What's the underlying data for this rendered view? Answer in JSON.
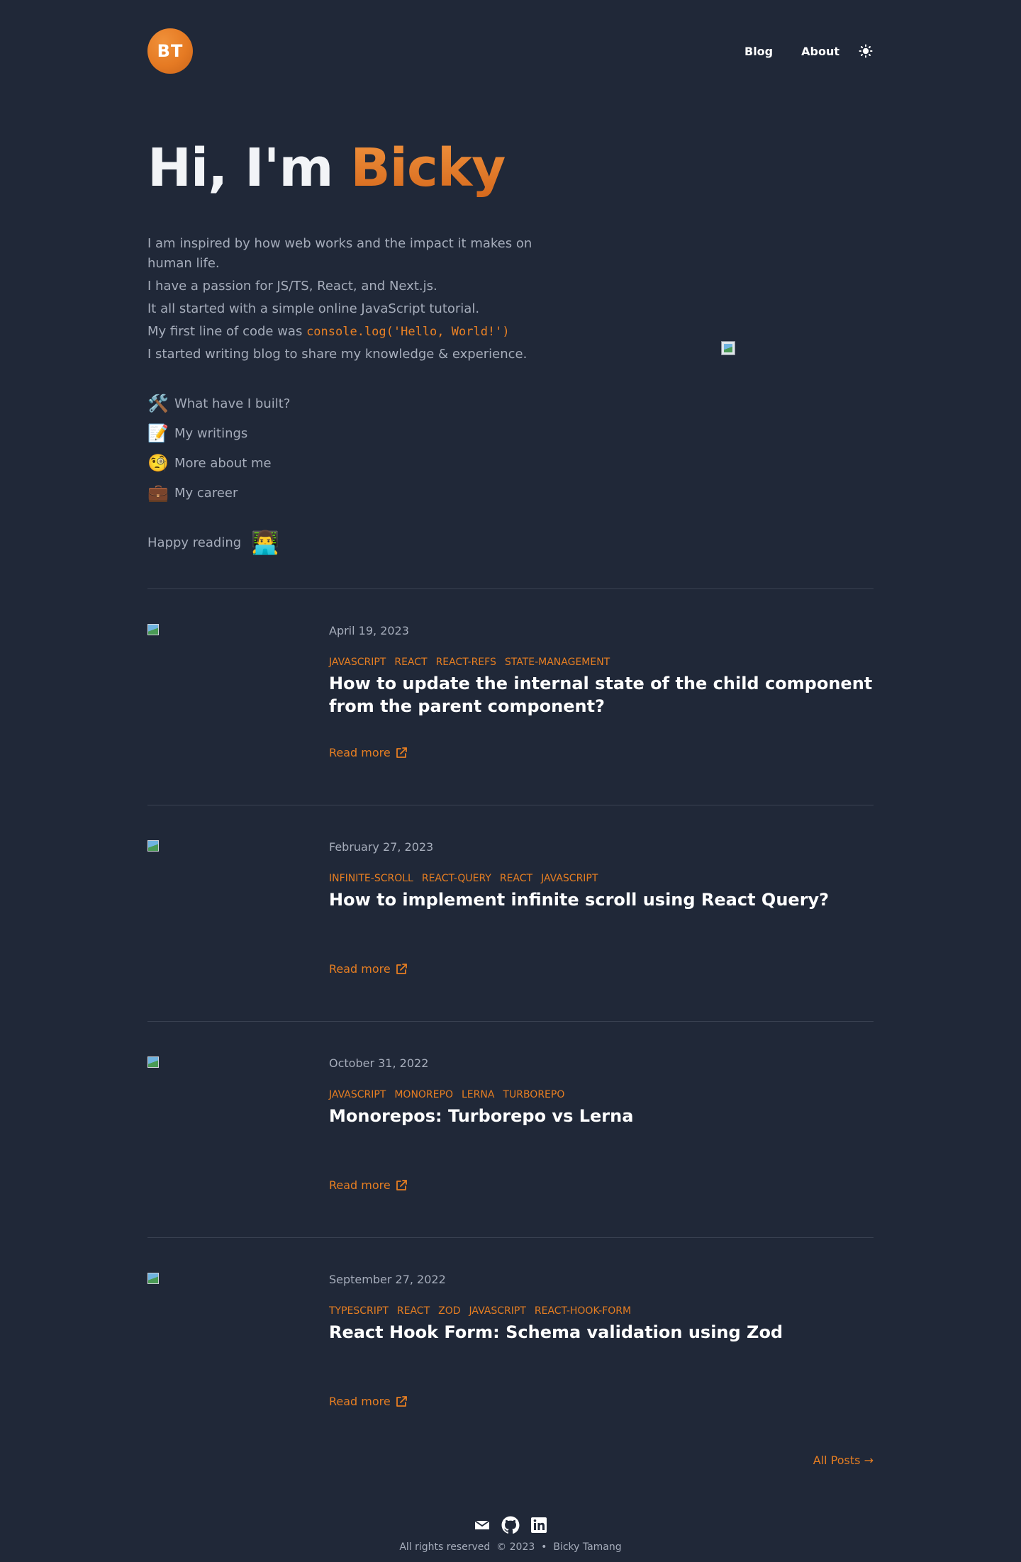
{
  "header": {
    "logo_text": "BT",
    "nav": [
      {
        "label": "Blog"
      },
      {
        "label": "About"
      }
    ],
    "theme_toggle_icon": "sun-icon"
  },
  "hero": {
    "greeting": "Hi, I'm ",
    "name": "Bicky",
    "intro": [
      "I am inspired by how web works and the impact it makes on human life.",
      "I have a passion for JS/TS, React, and Next.js.",
      "It all started with a simple online JavaScript tutorial.",
      "I started writing blog to share my knowledge & experience."
    ],
    "first_code_prefix": "My first line of code was ",
    "first_code": "console.log('Hello, World!')",
    "links": [
      {
        "emoji": "🛠️",
        "label": "What have I built?"
      },
      {
        "emoji": "📝",
        "label": "My writings"
      },
      {
        "emoji": "🧐",
        "label": "More about me"
      },
      {
        "emoji": "💼",
        "label": "My career"
      }
    ],
    "happy_text": "Happy reading",
    "happy_emoji": "👨‍💻"
  },
  "posts": [
    {
      "date": "April 19, 2023",
      "tags": [
        "JAVASCRIPT",
        "REACT",
        "REACT-REFS",
        "STATE-MANAGEMENT"
      ],
      "title": "How to update the internal state of the child component from the parent component?",
      "read_more": "Read more"
    },
    {
      "date": "February 27, 2023",
      "tags": [
        "INFINITE-SCROLL",
        "REACT-QUERY",
        "REACT",
        "JAVASCRIPT"
      ],
      "title": "How to implement infinite scroll using React Query?",
      "read_more": "Read more"
    },
    {
      "date": "October 31, 2022",
      "tags": [
        "JAVASCRIPT",
        "MONOREPO",
        "LERNA",
        "TURBOREPO"
      ],
      "title": "Monorepos: Turborepo vs Lerna",
      "read_more": "Read more"
    },
    {
      "date": "September 27, 2022",
      "tags": [
        "TYPESCRIPT",
        "REACT",
        "ZOD",
        "JAVASCRIPT",
        "REACT-HOOK-FORM"
      ],
      "title": "React Hook Form: Schema validation using Zod",
      "read_more": "Read more"
    }
  ],
  "all_posts": "All Posts →",
  "footer": {
    "icons": [
      "mail-icon",
      "github-icon",
      "linkedin-icon"
    ],
    "text": "All rights reserved  © 2023  •  Bicky Tamang"
  },
  "colors": {
    "background": "#202838",
    "accent": "#e67e22",
    "text": "#a6adbb",
    "heading": "#ffffff"
  }
}
